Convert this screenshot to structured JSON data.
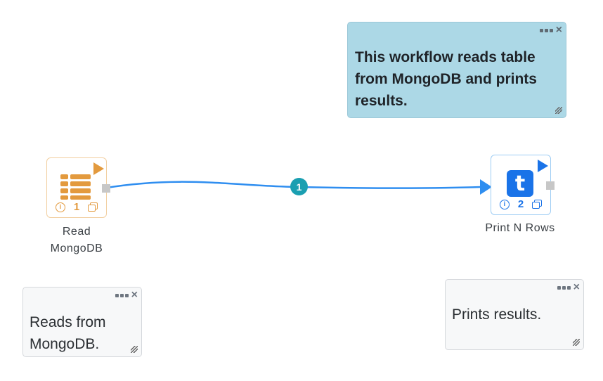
{
  "colors": {
    "note_main_bg": "#acd8e6",
    "read_node_accent": "#e39a3e",
    "print_node_accent": "#1a73e8",
    "edge_color": "#2f8ef0",
    "edge_badge_bg": "#1a9fb1"
  },
  "notes": {
    "main": {
      "text": "This workflow reads table\nfrom MongoDB and prints\nresults."
    },
    "left": {
      "text": "Reads from\nMongoDB."
    },
    "right": {
      "text": "Prints results."
    }
  },
  "nodes": {
    "read": {
      "label": "Read\nMongoDB",
      "number": "1",
      "icon": "table-rows-icon"
    },
    "print": {
      "label": "Print N Rows",
      "number": "2",
      "icon": "t-letter-icon",
      "icon_glyph": "t"
    }
  },
  "edge": {
    "badge": "1"
  },
  "glyphs": {
    "close": "×",
    "info": "i"
  }
}
